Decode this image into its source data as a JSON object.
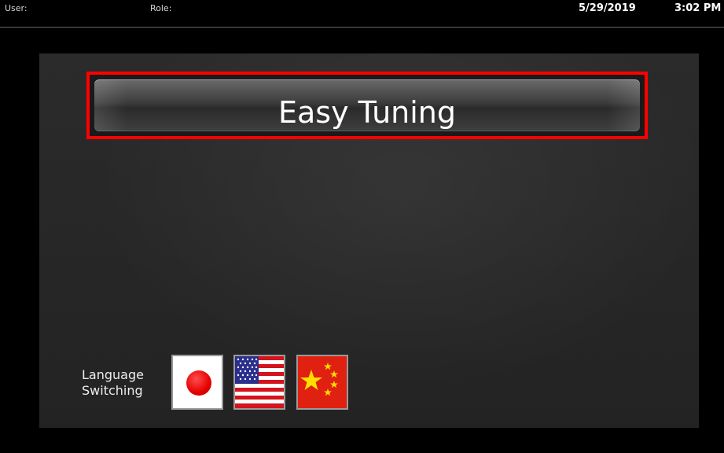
{
  "topbar": {
    "user_label": "User:",
    "role_label": "Role:",
    "date": "5/29/2019",
    "time": "3:02 PM"
  },
  "main": {
    "title": "Easy Tuning",
    "language_label_line1": "Language",
    "language_label_line2": "Switching",
    "languages": [
      {
        "icon": "japan-flag-icon"
      },
      {
        "icon": "us-flag-icon"
      },
      {
        "icon": "china-flag-icon"
      }
    ]
  },
  "colors": {
    "highlight_border": "#ff0000",
    "background": "#000000",
    "panel": "#2a2a2a"
  }
}
